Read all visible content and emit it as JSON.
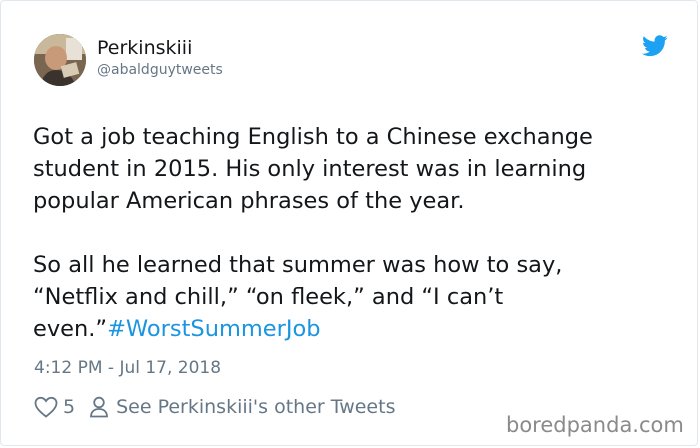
{
  "tweet": {
    "author": {
      "display_name": "Perkinskiii",
      "handle": "@abaldguytweets",
      "avatar_icon": "user-avatar"
    },
    "brand_icon": "twitter-bird-icon",
    "brand_color": "#1da1f2",
    "lines": [
      "Got a job teaching English to a Chinese exchange",
      "student in 2015. His only interest was in learning",
      "popular American phrases of the year.",
      "So all he learned that summer was how to say,",
      "“Netflix and chill,” “on fleek,” and “I can’t",
      "even.”"
    ],
    "hashtag": "#WorstSummerJob",
    "hashtag_color": "#1b95e0",
    "timestamp": "4:12 PM - Jul 17, 2018",
    "likes": "5",
    "like_icon": "heart-icon",
    "other_tweets_icon": "person-icon",
    "other_tweets_label": "See Perkinskiii's other Tweets"
  },
  "watermark": "boredpanda.com"
}
